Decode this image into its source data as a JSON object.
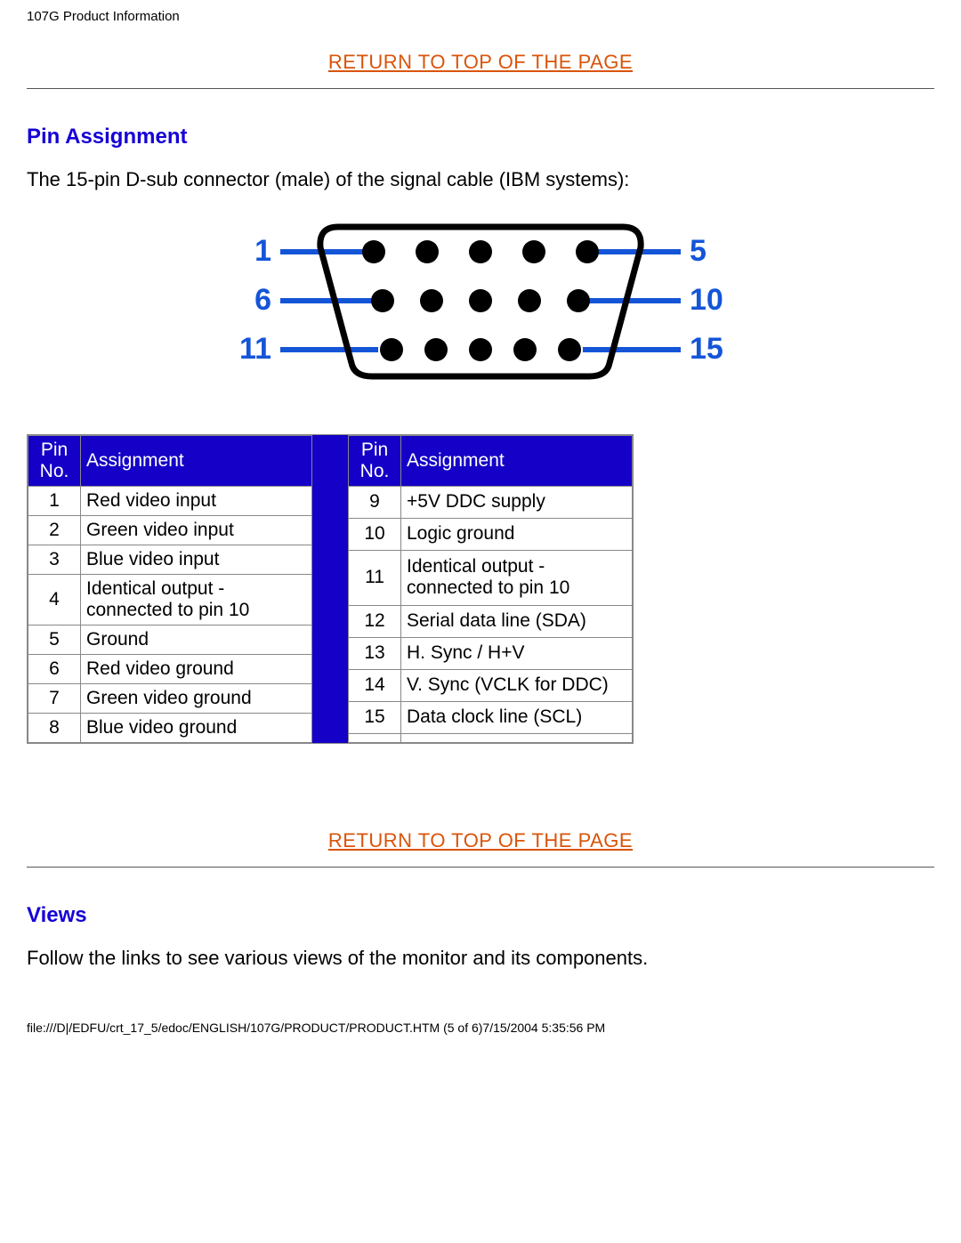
{
  "header": {
    "title": "107G Product Information"
  },
  "links": {
    "return_top": "RETURN TO TOP OF THE PAGE"
  },
  "sections": {
    "pin_assignment": {
      "heading": "Pin Assignment",
      "intro": "The 15-pin D-sub connector (male) of the signal cable (IBM systems):"
    },
    "views": {
      "heading": "Views",
      "intro": "Follow the links to see various views of the monitor and its components."
    }
  },
  "diagram": {
    "left_labels": [
      "1",
      "6",
      "11"
    ],
    "right_labels": [
      "5",
      "10",
      "15"
    ]
  },
  "pin_table": {
    "cols": {
      "pin": "Pin No.",
      "assign": "Assignment"
    },
    "left": [
      {
        "pin": "1",
        "assign": "Red video input"
      },
      {
        "pin": "2",
        "assign": "Green video input"
      },
      {
        "pin": "3",
        "assign": "Blue video input"
      },
      {
        "pin": "4",
        "assign": "Identical output - connected to pin 10"
      },
      {
        "pin": "5",
        "assign": "Ground"
      },
      {
        "pin": "6",
        "assign": "Red video ground"
      },
      {
        "pin": "7",
        "assign": "Green video ground"
      },
      {
        "pin": "8",
        "assign": "Blue video ground"
      }
    ],
    "right": [
      {
        "pin": "9",
        "assign": "+5V DDC supply"
      },
      {
        "pin": "10",
        "assign": "Logic ground"
      },
      {
        "pin": "11",
        "assign": "Identical output - connected to pin 10"
      },
      {
        "pin": "12",
        "assign": "Serial data line (SDA)"
      },
      {
        "pin": "13",
        "assign": "H. Sync / H+V"
      },
      {
        "pin": "14",
        "assign": "V. Sync (VCLK for DDC)"
      },
      {
        "pin": "15",
        "assign": "Data clock line (SCL)"
      },
      {
        "pin": "",
        "assign": ""
      }
    ]
  },
  "footer": {
    "text": "file:///D|/EDFU/crt_17_5/edoc/ENGLISH/107G/PRODUCT/PRODUCT.HTM (5 of 6)7/15/2004 5:35:56 PM"
  }
}
